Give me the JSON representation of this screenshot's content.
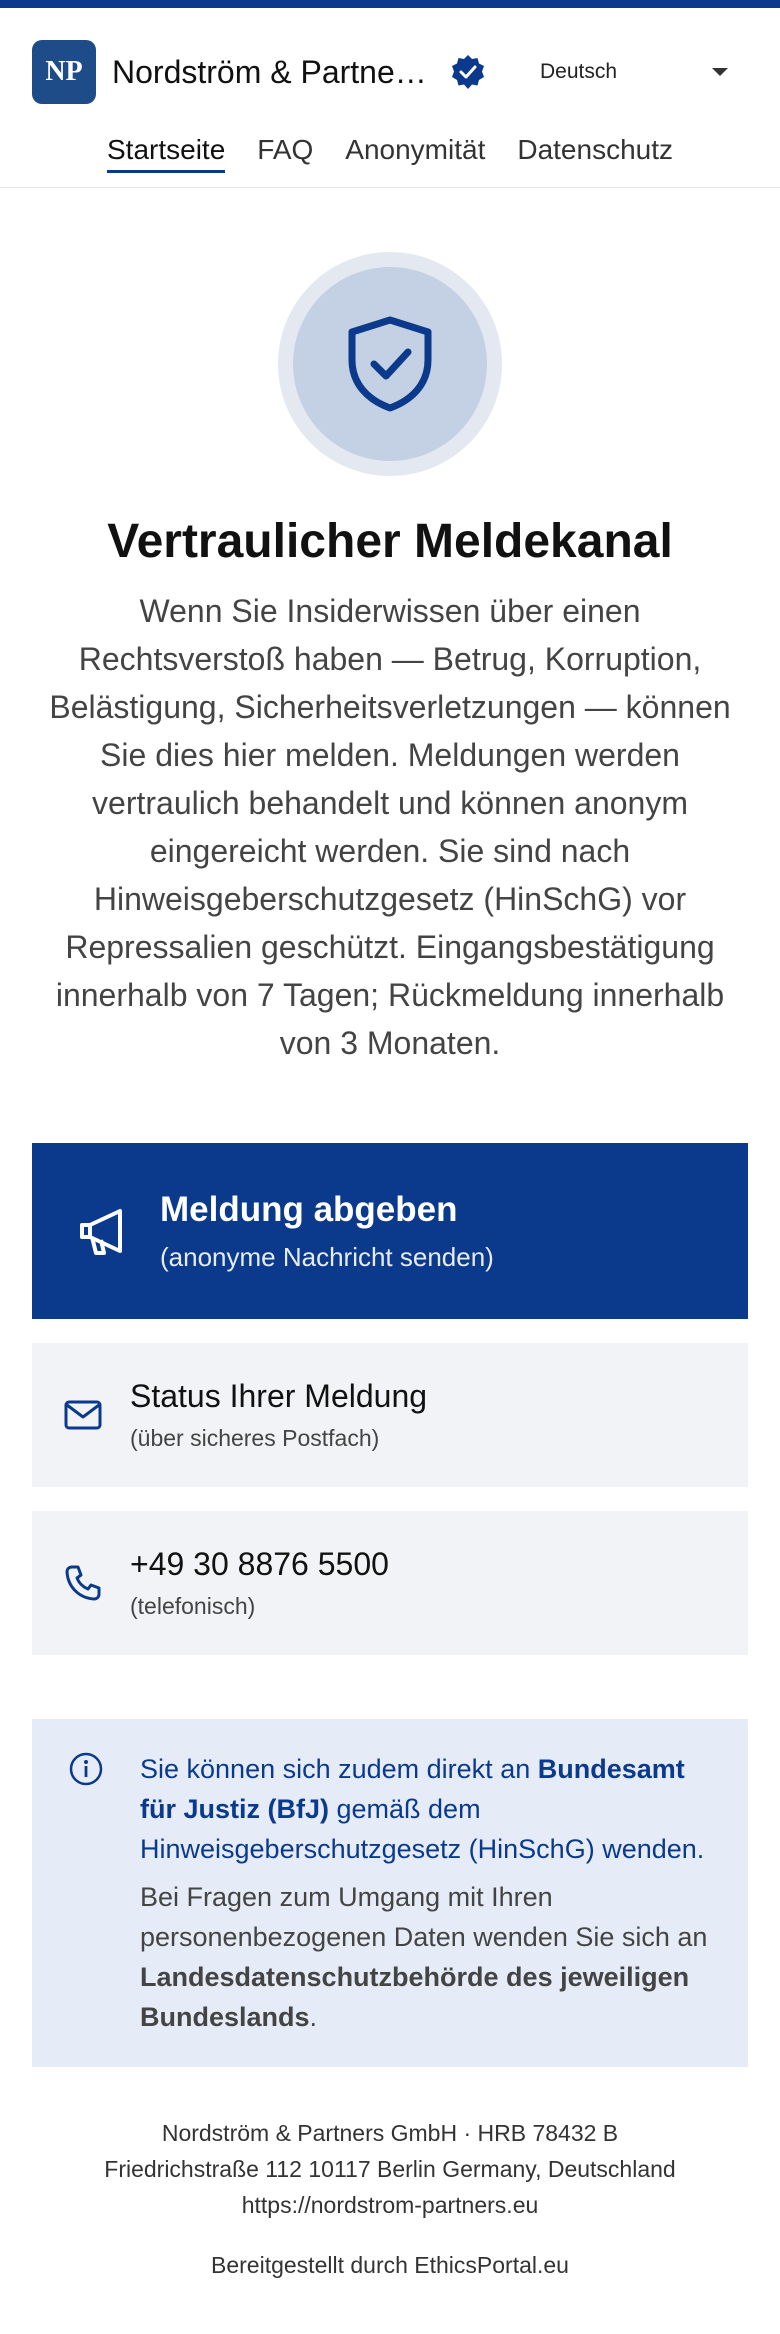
{
  "header": {
    "logo_text": "NP",
    "company_name": "Nordström & Partners GmbH",
    "language": "Deutsch"
  },
  "nav": {
    "items": [
      {
        "label": "Startseite"
      },
      {
        "label": "FAQ"
      },
      {
        "label": "Anonymität"
      },
      {
        "label": "Datenschutz"
      }
    ]
  },
  "hero": {
    "title": "Vertraulicher Meldekanal",
    "intro": "Wenn Sie Insiderwissen über einen Rechtsverstoß haben — Betrug, Korruption, Belästigung, Sicherheitsverletzungen — können Sie dies hier melden. Meldungen werden vertraulich behandelt und können anonym eingereicht werden. Sie sind nach Hinweisgeberschutzgesetz (HinSchG) vor Repressalien geschützt. Eingangsbestätigung innerhalb von 7 Tagen; Rückmeldung innerhalb von 3 Monaten."
  },
  "actions": {
    "report": {
      "title": "Meldung abgeben",
      "subtitle": "(anonyme Nachricht senden)"
    },
    "status": {
      "title": "Status Ihrer Meldung",
      "subtitle": "(über sicheres Postfach)"
    },
    "phone": {
      "title": "+49 30 8876 5500",
      "subtitle": "(telefonisch)"
    }
  },
  "info": {
    "p1_pre": "Sie können sich zudem direkt an ",
    "p1_bold": "Bundesamt für Justiz (BfJ)",
    "p1_post": " gemäß dem Hinweisgeberschutzgesetz (HinSchG) wenden.",
    "p2_pre": "Bei Fragen zum Umgang mit Ihren personenbezogenen Daten wenden Sie sich an ",
    "p2_bold": "Landesdatenschutzbehörde des jeweiligen Bundeslands",
    "p2_post": "."
  },
  "footer": {
    "line1": "Nordström & Partners GmbH · HRB 78432 B",
    "line2": "Friedrichstraße 112 10117 Berlin Germany, Deutschland",
    "website": "https://nordstrom-partners.eu",
    "powered_by": "Bereitgestellt durch EthicsPortal.eu"
  },
  "icons": {
    "verified": "verified-badge-icon",
    "shield": "shield-check-icon",
    "megaphone": "megaphone-icon",
    "mail": "mail-icon",
    "phone": "phone-icon",
    "info": "info-icon"
  },
  "colors": {
    "brand_primary": "#0b3a8c",
    "logo_bg": "#1e4c88",
    "info_bg": "#e6ecf7",
    "card_bg": "#f2f3f6"
  }
}
